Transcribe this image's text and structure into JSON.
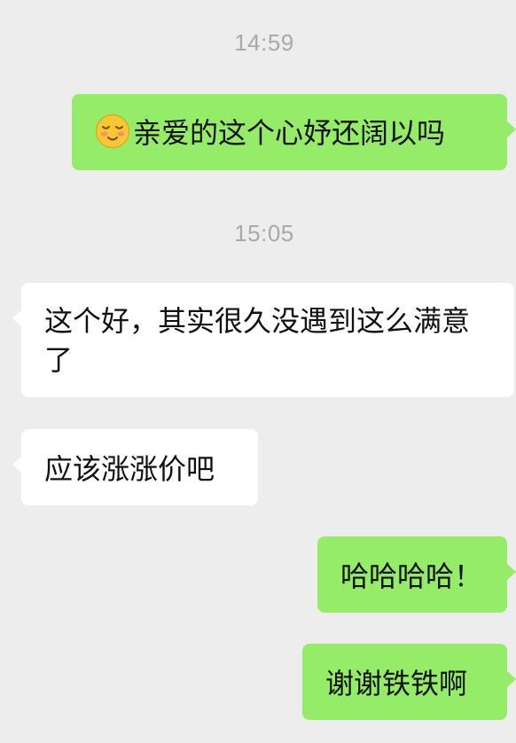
{
  "chat": {
    "timestamps": [
      "14:59",
      "15:05"
    ],
    "messages": [
      {
        "side": "out",
        "emoji": "blushing-smile-emoji",
        "text": "亲爱的这个心妤还阔以吗"
      },
      {
        "side": "in",
        "text": "这个好，其实很久没遇到这么满意了"
      },
      {
        "side": "in",
        "text": "应该涨涨价吧"
      },
      {
        "side": "out",
        "text": "哈哈哈哈！"
      },
      {
        "side": "out",
        "text": "谢谢铁铁啊"
      }
    ]
  },
  "colors": {
    "background": "#ededed",
    "outgoing_bubble": "#95ec69",
    "incoming_bubble": "#ffffff",
    "timestamp": "#a9a9a9",
    "text": "#111111"
  }
}
